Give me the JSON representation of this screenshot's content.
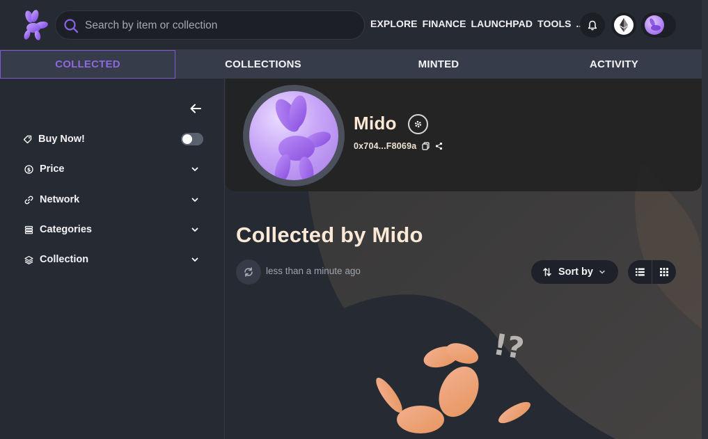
{
  "search": {
    "placeholder": "Search by item or collection"
  },
  "nav": {
    "links": [
      "EXPLORE",
      "FINANCE",
      "LAUNCHPAD",
      "TOOLS",
      "..."
    ]
  },
  "tabs": [
    {
      "label": "COLLECTED",
      "active": true
    },
    {
      "label": "COLLECTIONS",
      "active": false
    },
    {
      "label": "MINTED",
      "active": false
    },
    {
      "label": "ACTIVITY",
      "active": false
    }
  ],
  "sidebar": {
    "filters": [
      {
        "label": "Buy Now!",
        "icon": "tag-icon",
        "control": "toggle",
        "on": false
      },
      {
        "label": "Price",
        "icon": "dollar-icon",
        "control": "chevron"
      },
      {
        "label": "Network",
        "icon": "link-icon",
        "control": "chevron"
      },
      {
        "label": "Categories",
        "icon": "stack-icon",
        "control": "chevron"
      },
      {
        "label": "Collection",
        "icon": "layers-icon",
        "control": "chevron"
      }
    ]
  },
  "profile": {
    "name": "Mido",
    "wallet": "0x704...F8069a"
  },
  "main": {
    "title": "Collected by Mido",
    "updated": "less than a minute ago",
    "sort_label": "Sort by",
    "empty_glyph": "!?"
  },
  "colors": {
    "accent": "#8d68e0",
    "title_cream": "#fbe9d6",
    "background": "#262a33",
    "tab_bar": "#363c49"
  }
}
